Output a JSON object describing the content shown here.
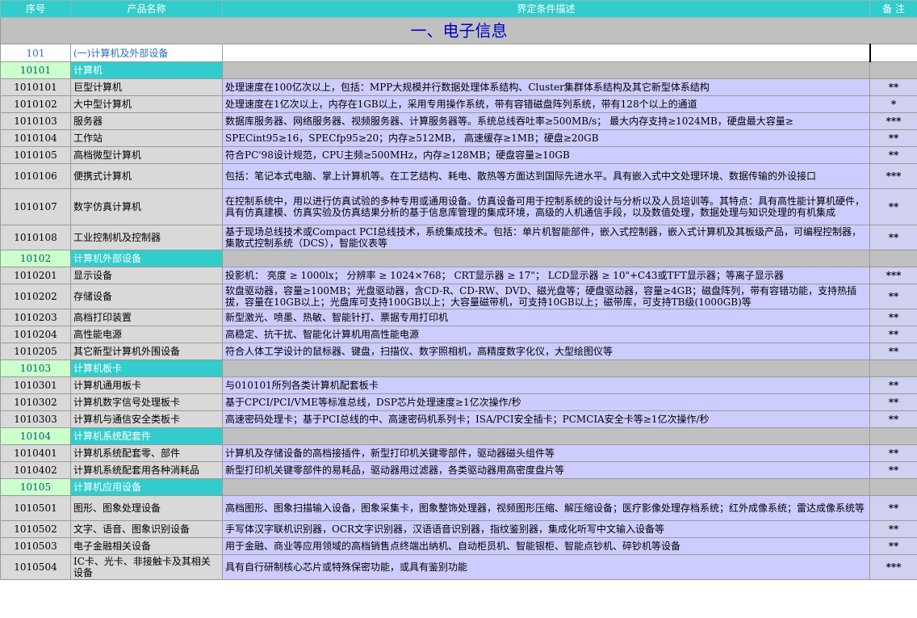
{
  "header": {
    "col_code": "序号",
    "col_name": "产品名称",
    "col_desc": "界定条件描述",
    "col_note": "备 注"
  },
  "title": "一、电子信息",
  "section": {
    "code": "101",
    "name": "(一)计算机及外部设备"
  },
  "groups": [
    {
      "code": "10101",
      "name": "计算机",
      "rows": [
        {
          "code": "1010101",
          "name": "巨型计算机",
          "desc": "处理速度在100亿次以上，包括：MPP大规模并行数据处理体系结构、Cluster集群体系结构及其它新型体系结构",
          "note": "**",
          "h": 1
        },
        {
          "code": "1010102",
          "name": "大中型计算机",
          "desc": "处理速度在1亿次以上，内存在1GB以上，采用专用操作系统，带有容错磁盘阵列系统，带有128个以上的通道",
          "note": "*",
          "h": 1
        },
        {
          "code": "1010103",
          "name": "服务器",
          "desc": "数据库服务器、网络服务器、视频服务器、计算服务器等。系统总线吞吐率≥500MB/s； 最大内存支持≥1024MB，硬盘最大容量≥",
          "note": "***",
          "h": 1
        },
        {
          "code": "1010104",
          "name": "工作站",
          "desc": "SPECint95≥16，SPECfp95≥20；内存≥512MB， 高速缓存≥1MB；硬盘≥20GB",
          "note": "**",
          "h": 1
        },
        {
          "code": "1010105",
          "name": "高档微型计算机",
          "desc": "符合PC'98设计规范，CPU主频≥500MHz，内存≥128MB；硬盘容量≥10GB",
          "note": "**",
          "h": 1
        },
        {
          "code": "1010106",
          "name": "便携式计算机",
          "desc": "包括：笔记本式电脑、掌上计算机等。在工艺结构、耗电、散热等方面达到国际先进水平。具有嵌入式中文处理环境、数据传输的外设接口",
          "note": "***",
          "h": 2
        },
        {
          "code": "1010107",
          "name": "数字仿真计算机",
          "desc": "在控制系统中，用以进行仿真试验的多种专用或通用设备。仿真设备可用于控制系统的设计与分析以及人员培训等。其特点：具有高性能计算机硬件，具有仿真建模、仿真实验及仿真结果分析的基于信息库管理的集成环境，高级的人机通信手段，以及数值处理，数据处理与知识处理的有机集成",
          "note": "**",
          "h": 3
        },
        {
          "code": "1010108",
          "name": "工业控制机及控制器",
          "desc": "基于现场总线技术或Compact PCI总线技术，系统集成技术。包括：单片机智能部件，嵌入式控制器，嵌入式计算机及其板级产品，可编程控制器，集散式控制系统（DCS），智能仪表等",
          "note": "**",
          "h": 2
        }
      ]
    },
    {
      "code": "10102",
      "name": "计算机外部设备",
      "rows": [
        {
          "code": "1010201",
          "name": "显示设备",
          "desc": "投影机： 亮度 ≥ 1000lx； 分辨率 ≥ 1024×768； CRT显示器 ≥ 17\"； LCD显示器 ≥ 10\"+C43或TFT显示器；等离子显示器",
          "note": "***",
          "h": 1
        },
        {
          "code": "1010202",
          "name": "存储设备",
          "desc": "软盘驱动器，容量≥100MB；光盘驱动器，含CD-R、CD-RW、DVD、磁光盘等；硬盘驱动器，容量≥4GB；磁盘阵列，带有容错功能，支持热插拔，容量在10GB以上；光盘库可支持100GB以上；大容量磁带机，可支持10GB以上；磁带库，可支持TB级(1000GB)等",
          "note": "**",
          "h": 2
        },
        {
          "code": "1010203",
          "name": "高档打印装置",
          "desc": "新型激光、喷墨、热敏、智能针打、票据专用打印机",
          "note": "**",
          "h": 1
        },
        {
          "code": "1010204",
          "name": "高性能电源",
          "desc": "高稳定、抗干扰、智能化计算机用高性能电源",
          "note": "**",
          "h": 1
        },
        {
          "code": "1010205",
          "name": "其它新型计算机外围设备",
          "desc": "符合人体工学设计的鼠标器、键盘，扫描仪、数字照相机，高精度数字化仪，大型绘图仪等",
          "note": "**",
          "h": 1
        }
      ]
    },
    {
      "code": "10103",
      "name": "计算机板卡",
      "rows": [
        {
          "code": "1010301",
          "name": "计算机通用板卡",
          "desc": "与010101所列各类计算机配套板卡",
          "note": "**",
          "h": 1
        },
        {
          "code": "1010302",
          "name": "计算机数字信号处理板卡",
          "desc": "基于CPCI/PCI/VME等标准总线，DSP芯片处理速度≥1亿次操作/秒",
          "note": "**",
          "h": 1
        },
        {
          "code": "1010303",
          "name": "计算机与通信安全类板卡",
          "desc": "高速密码处理卡；基于PCI总线的中、高速密码机系列卡；ISA/PCI安全插卡；PCMCIA安全卡等≥1亿次操作/秒",
          "note": "**",
          "h": 1
        }
      ]
    },
    {
      "code": "10104",
      "name": "计算机系统配套件",
      "rows": [
        {
          "code": "1010401",
          "name": "计算机系统配套零、部件",
          "desc": "计算机及存储设备的高档接插件，新型打印机关键零部件，驱动器磁头组件等",
          "note": "**",
          "h": 1
        },
        {
          "code": "1010402",
          "name": "计算机系统配套用各种消耗品",
          "desc": "新型打印机关键零部件的易耗品，驱动器用过滤器，各类驱动器用高密度盘片等",
          "note": "**",
          "h": 1
        }
      ]
    },
    {
      "code": "10105",
      "name": "计算机应用设备",
      "rows": [
        {
          "code": "1010501",
          "name": "图形、图象处理设备",
          "desc": "高档图形、图象扫描输入设备，图象采集卡，图象整饰处理器，视频图形压缩、解压缩设备；医疗影像处理存档系统；红外成像系统；雷达成像系统等",
          "note": "**",
          "h": 2
        },
        {
          "code": "1010502",
          "name": "文字、语音、图象识别设备",
          "desc": "手写体汉字联机识别器，OCR文字识别器，汉语语音识别器，指纹鉴别器，集成化听写中文输入设备等",
          "note": "**",
          "h": 1
        },
        {
          "code": "1010503",
          "name": "电子金融相关设备",
          "desc": "用于金融、商业等应用领域的高档销售点终端出纳机、自动柜员机、智能银柜、智能点钞机、碎钞机等设备",
          "note": "**",
          "h": 1
        },
        {
          "code": "1010504",
          "name": "IC卡、光卡、非接触卡及其相关设备",
          "desc": "具有自行研制核心芯片或特殊保密功能，或具有鉴别功能",
          "note": "***",
          "h": 2
        }
      ]
    }
  ]
}
